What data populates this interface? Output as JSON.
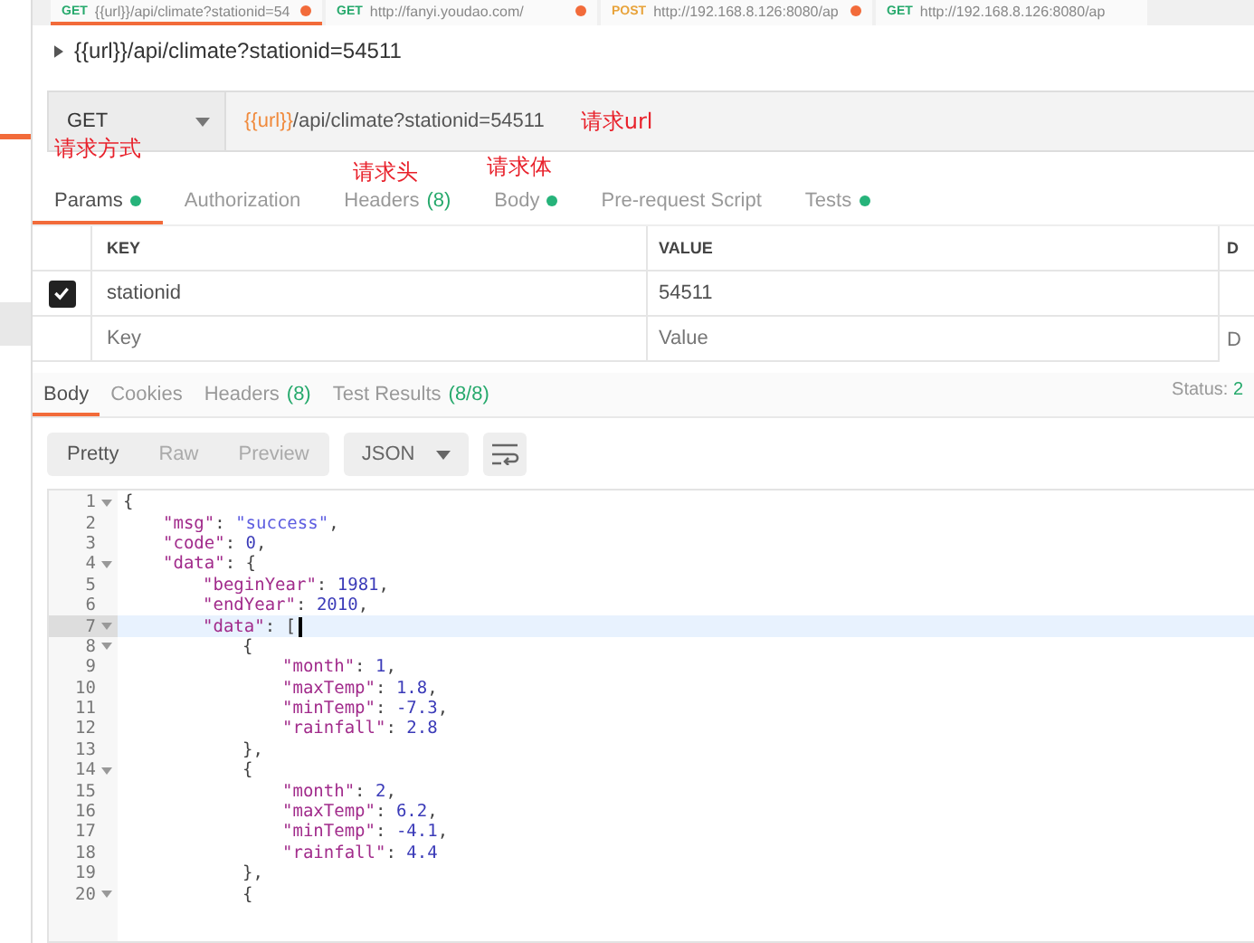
{
  "request_tabs": [
    {
      "method": "GET",
      "url": "{{url}}/api/climate?stationid=54",
      "unsaved": true,
      "selected": true
    },
    {
      "method": "GET",
      "url": "http://fanyi.youdao.com/",
      "unsaved": true,
      "selected": false
    },
    {
      "method": "POST",
      "url": "http://192.168.8.126:8080/ap",
      "unsaved": true,
      "selected": false
    },
    {
      "method": "GET",
      "url": "http://192.168.8.126:8080/ap",
      "unsaved": false,
      "selected": false
    }
  ],
  "request_name": "{{url}}/api/climate?stationid=54511",
  "method": "GET",
  "url": {
    "variable": "{{url}}",
    "path": "/api/climate?stationid=54511"
  },
  "annotations": [
    {
      "kind": "method",
      "text": "请求方式"
    },
    {
      "kind": "url",
      "text": "请求url"
    },
    {
      "kind": "headers",
      "text": "请求头"
    },
    {
      "kind": "body",
      "text": "请求体"
    }
  ],
  "request_tabs_lower": [
    {
      "label": "Params",
      "dot": true,
      "selected": true
    },
    {
      "label": "Authorization",
      "dot": false,
      "selected": false
    },
    {
      "label": "Headers",
      "dot": false,
      "count": "(8)",
      "selected": false
    },
    {
      "label": "Body",
      "dot": true,
      "selected": false
    },
    {
      "label": "Pre-request Script",
      "dot": false,
      "selected": false
    },
    {
      "label": "Tests",
      "dot": true,
      "selected": false
    }
  ],
  "params": {
    "columns": [
      "KEY",
      "VALUE",
      "D"
    ],
    "rows": [
      {
        "key": "stationid",
        "value": "54511",
        "checked": true
      }
    ],
    "placeholder_key": "Key",
    "placeholder_value": "Value",
    "placeholder_desc": "D"
  },
  "response_tabs": [
    {
      "label": "Body",
      "selected": true
    },
    {
      "label": "Cookies",
      "selected": false
    },
    {
      "label": "Headers",
      "count": "(8)",
      "selected": false
    },
    {
      "label": "Test Results",
      "count": "(8/8)",
      "selected": false
    }
  ],
  "status": {
    "label": "Status:",
    "value": "2"
  },
  "view_modes": [
    {
      "label": "Pretty",
      "selected": true
    },
    {
      "label": "Raw",
      "selected": false
    },
    {
      "label": "Preview",
      "selected": false
    }
  ],
  "format": "JSON",
  "code": [
    {
      "n": "1",
      "fold": true,
      "text": "{",
      "active": false,
      "children": [
        {
          "n": "2",
          "fold": false,
          "text": "\"msg\": \"success\",",
          "active": false
        },
        {
          "n": "3",
          "fold": false,
          "text": "\"code\": 0,",
          "active": false
        },
        {
          "n": "4",
          "fold": true,
          "text": "\"data\": {",
          "active": false,
          "children": [
            {
              "n": "5",
              "fold": false,
              "text": "\"beginYear\": 1981,",
              "active": false
            },
            {
              "n": "6",
              "fold": false,
              "text": "\"endYear\": 2010,",
              "active": false
            },
            {
              "n": "7",
              "fold": true,
              "text": "\"data\": [",
              "active": true,
              "children": [
                {
                  "n": "8",
                  "fold": true,
                  "text": "{",
                  "active": false,
                  "children": [
                    {
                      "n": "9",
                      "fold": false,
                      "text": "\"month\": 1,",
                      "active": false
                    },
                    {
                      "n": "10",
                      "fold": false,
                      "text": "\"maxTemp\": 1.8,",
                      "active": false
                    },
                    {
                      "n": "11",
                      "fold": false,
                      "text": "\"minTemp\": -7.3,",
                      "active": false
                    },
                    {
                      "n": "12",
                      "fold": false,
                      "text": "\"rainfall\": 2.8",
                      "active": false
                    }
                  ]
                },
                {
                  "n": "13",
                  "fold": false,
                  "text": "},",
                  "active": false
                },
                {
                  "n": "14",
                  "fold": true,
                  "text": "{",
                  "active": false,
                  "children": [
                    {
                      "n": "15",
                      "fold": false,
                      "text": "\"month\": 2,",
                      "active": false
                    },
                    {
                      "n": "16",
                      "fold": false,
                      "text": "\"maxTemp\": 6.2,",
                      "active": false
                    },
                    {
                      "n": "17",
                      "fold": false,
                      "text": "\"minTemp\": -4.1,",
                      "active": false
                    },
                    {
                      "n": "18",
                      "fold": false,
                      "text": "\"rainfall\": 4.4",
                      "active": false
                    }
                  ]
                },
                {
                  "n": "19",
                  "fold": false,
                  "text": "},",
                  "active": false
                },
                {
                  "n": "20",
                  "fold": true,
                  "text": "{",
                  "active": false
                }
              ]
            }
          ]
        }
      ]
    }
  ]
}
